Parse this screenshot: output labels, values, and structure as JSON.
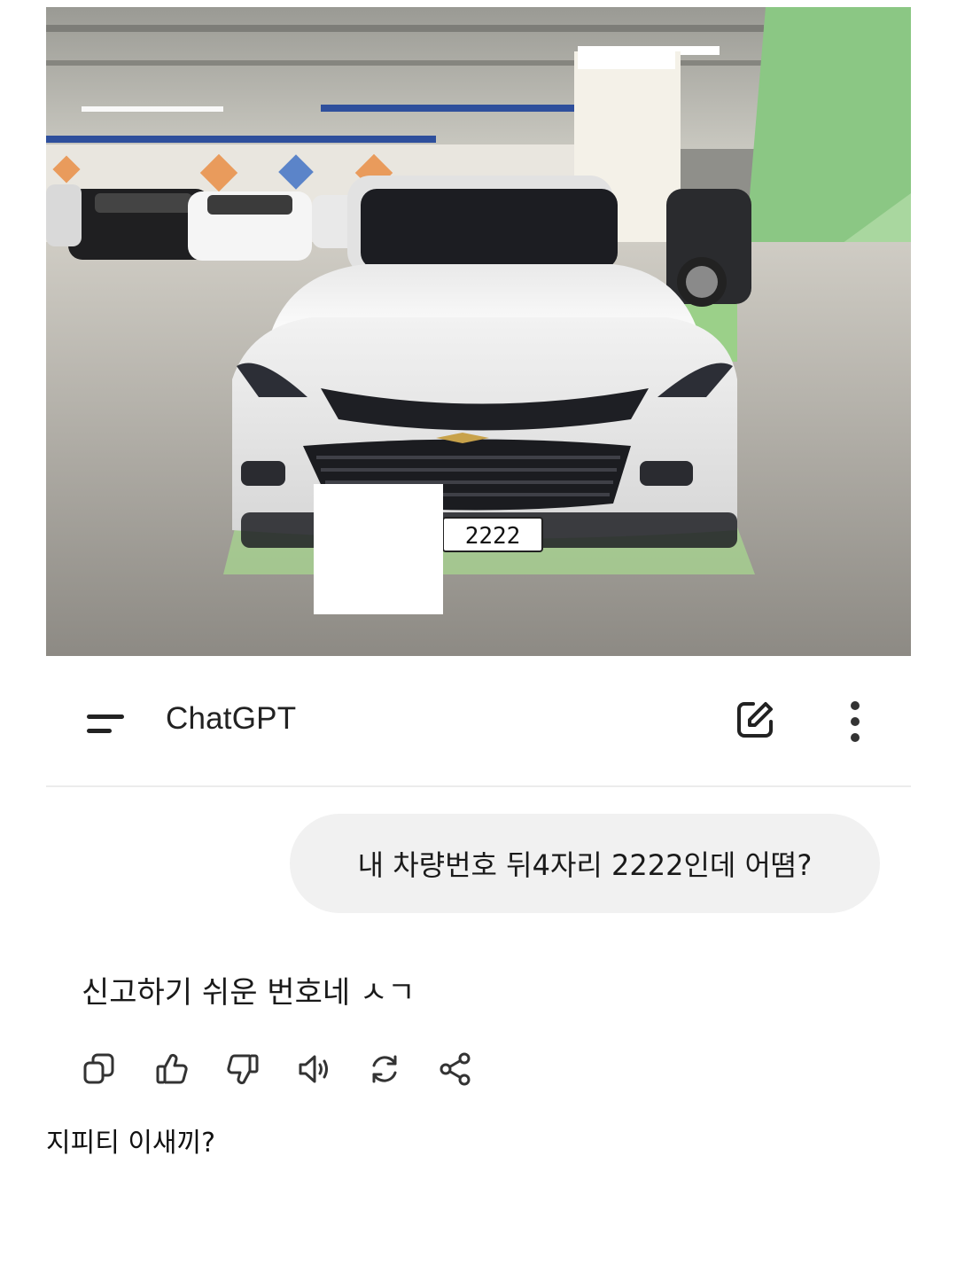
{
  "photo": {
    "plate_number": "2222"
  },
  "header": {
    "title": "ChatGPT"
  },
  "conversation": {
    "user_message": "내 차량번호 뒤4자리 2222인데 어뗨?",
    "assistant_message": "신고하기 쉬운 번호네 ㅅㄱ"
  },
  "actions": [
    {
      "icon": "copy-icon"
    },
    {
      "icon": "thumbs-up-icon"
    },
    {
      "icon": "thumbs-down-icon"
    },
    {
      "icon": "speaker-icon"
    },
    {
      "icon": "regenerate-icon"
    },
    {
      "icon": "share-icon"
    }
  ],
  "caption": "지피티 이새끼?",
  "colors": {
    "bubble_bg": "#f1f1f1",
    "text": "#1a1a1a",
    "pillar_green": "#7cc576"
  }
}
